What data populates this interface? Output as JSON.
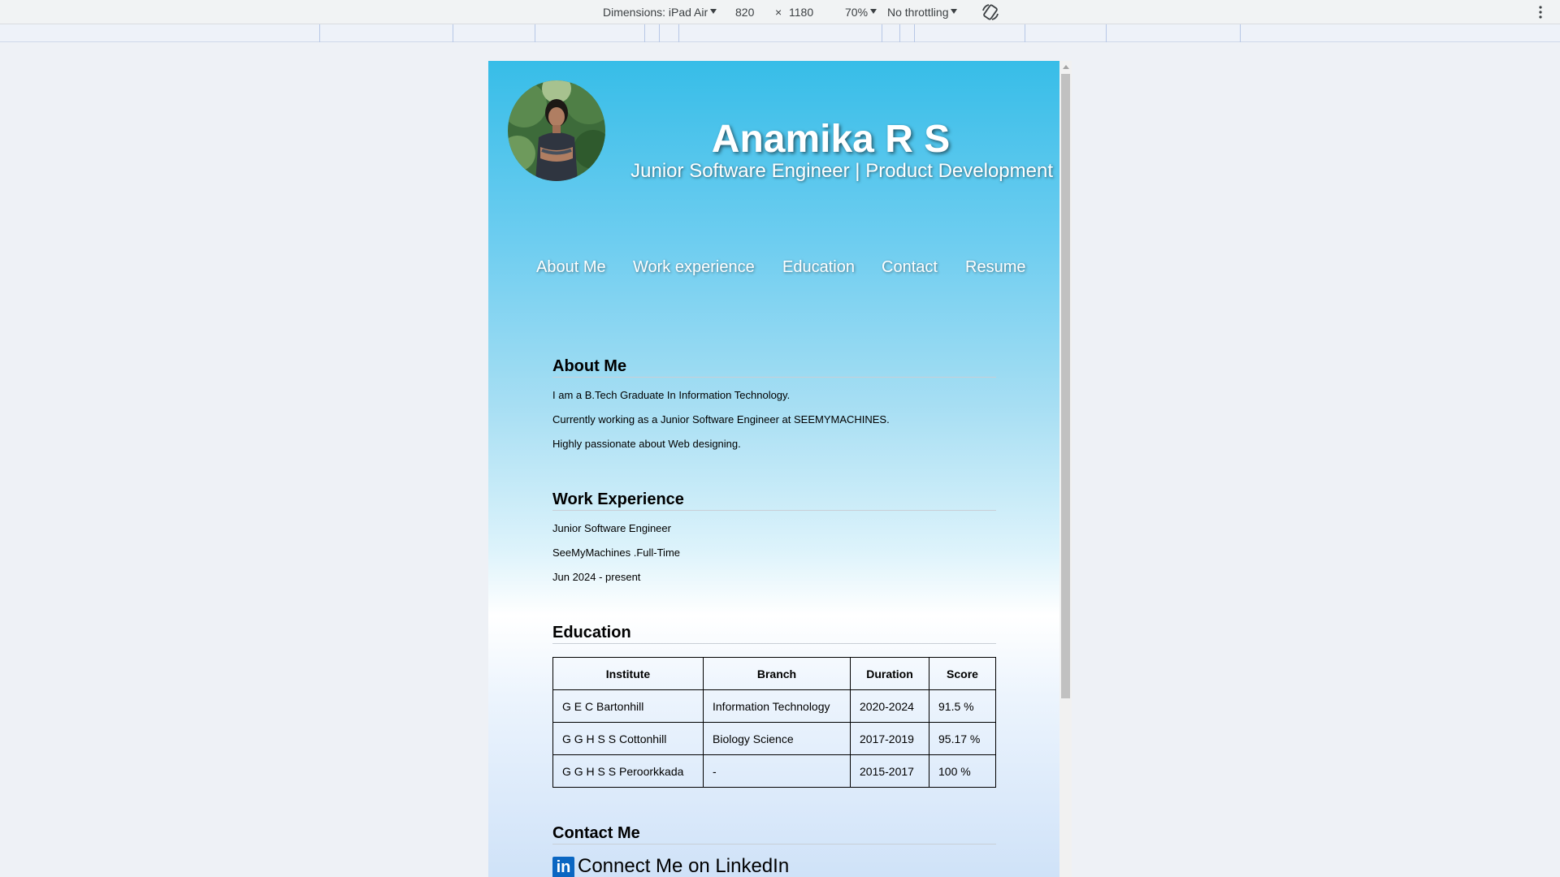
{
  "devtools": {
    "dimensions_label": "Dimensions: iPad Air",
    "width": "820",
    "times": "×",
    "height": "1180",
    "zoom": "70%",
    "throttling": "No throttling",
    "icons": [
      "rotate-icon",
      "more-vert-icon"
    ]
  },
  "header": {
    "name": "Anamika R S",
    "tagline": "Junior Software Engineer | Product Development",
    "avatar_colors": {
      "foliage": "#3d6b3a",
      "skin": "#b07e62",
      "hair": "#1d1915",
      "top": "#2f3540"
    }
  },
  "nav": [
    "About Me",
    "Work experience",
    "Education",
    "Contact",
    "Resume"
  ],
  "about": {
    "title": "About Me",
    "lines": [
      "I am a B.Tech Graduate In Information Technology.",
      "Currently working as a Junior Software Engineer at SEEMYMACHINES.",
      "Highly passionate about Web designing."
    ]
  },
  "work": {
    "title": "Work Experience",
    "lines": [
      "Junior Software Engineer",
      "SeeMyMachines .Full-Time",
      "Jun 2024 - present"
    ]
  },
  "education": {
    "title": "Education",
    "headers": [
      "Institute",
      "Branch",
      "Duration",
      "Score"
    ],
    "rows": [
      [
        "G E C Bartonhill",
        "Information Technology",
        "2020-2024",
        "91.5 %"
      ],
      [
        "G G H S S Cottonhill",
        "Biology Science",
        "2017-2019",
        "95.17 %"
      ],
      [
        "G G H S S Peroorkkada",
        "-",
        "2015-2017",
        "100 %"
      ]
    ]
  },
  "contact": {
    "title": "Contact Me",
    "linkedin_icon_text": "in",
    "linkedin_label": "Connect Me on LinkedIn",
    "linkedin_color": "#0a66c2"
  }
}
